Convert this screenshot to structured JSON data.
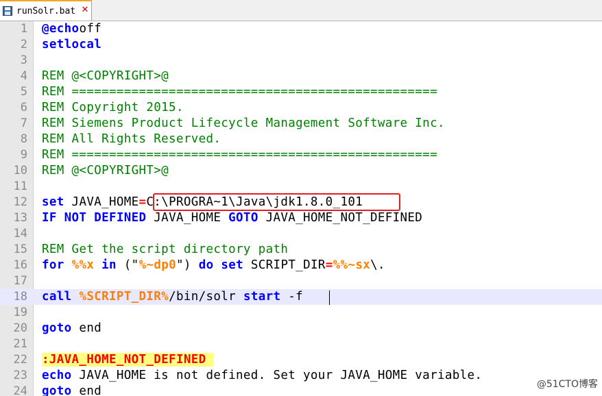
{
  "tab": {
    "title": "runSolr.bat",
    "icon": "save-icon",
    "close_icon": "close-icon"
  },
  "lines": [
    {
      "n": "1",
      "segs": [
        [
          "kw",
          "@echo"
        ],
        [
          "",
          "off"
        ]
      ]
    },
    {
      "n": "2",
      "segs": [
        [
          "kw",
          "setlocal"
        ]
      ]
    },
    {
      "n": "3",
      "segs": []
    },
    {
      "n": "4",
      "segs": [
        [
          "cmt",
          "REM @<COPYRIGHT>@"
        ]
      ]
    },
    {
      "n": "5",
      "segs": [
        [
          "cmt",
          "REM ================================================="
        ]
      ]
    },
    {
      "n": "6",
      "segs": [
        [
          "cmt",
          "REM Copyright 2015."
        ]
      ]
    },
    {
      "n": "7",
      "segs": [
        [
          "cmt",
          "REM Siemens Product Lifecycle Management Software Inc."
        ]
      ]
    },
    {
      "n": "8",
      "segs": [
        [
          "cmt",
          "REM All Rights Reserved."
        ]
      ]
    },
    {
      "n": "9",
      "segs": [
        [
          "cmt",
          "REM ================================================="
        ]
      ]
    },
    {
      "n": "10",
      "segs": [
        [
          "cmt",
          "REM @<COPYRIGHT>@"
        ]
      ]
    },
    {
      "n": "11",
      "segs": []
    },
    {
      "n": "12",
      "segs": [
        [
          "kw",
          "set"
        ],
        [
          "",
          " JAVA_HOME"
        ],
        [
          "op",
          "="
        ],
        [
          "",
          "C:\\PROGRA~1\\Java\\jdk1.8.0_101"
        ]
      ]
    },
    {
      "n": "13",
      "segs": [
        [
          "kw",
          "IF NOT DEFINED"
        ],
        [
          "",
          " JAVA_HOME "
        ],
        [
          "kw",
          "GOTO"
        ],
        [
          "",
          " JAVA_HOME_NOT_DEFINED"
        ]
      ]
    },
    {
      "n": "14",
      "segs": []
    },
    {
      "n": "15",
      "segs": [
        [
          "cmt",
          "REM Get the script directory path"
        ]
      ]
    },
    {
      "n": "16",
      "segs": [
        [
          "kw",
          "for"
        ],
        [
          "",
          " "
        ],
        [
          "var",
          "%%x"
        ],
        [
          "",
          " "
        ],
        [
          "kw",
          "in"
        ],
        [
          "",
          " (\""
        ],
        [
          "var",
          "%~dp0"
        ],
        [
          "",
          "\") "
        ],
        [
          "kw",
          "do set"
        ],
        [
          "",
          " SCRIPT_DIR"
        ],
        [
          "op",
          "="
        ],
        [
          "var",
          "%%~sx"
        ],
        [
          "",
          "\\."
        ]
      ]
    },
    {
      "n": "17",
      "segs": []
    },
    {
      "n": "18",
      "segs": [
        [
          "kw",
          "call"
        ],
        [
          "",
          " "
        ],
        [
          "var",
          "%SCRIPT_DIR%"
        ],
        [
          "",
          "/bin/solr "
        ],
        [
          "kw",
          "start"
        ],
        [
          "",
          " -f"
        ]
      ]
    },
    {
      "n": "19",
      "segs": []
    },
    {
      "n": "20",
      "segs": [
        [
          "kw",
          "goto"
        ],
        [
          "",
          " end"
        ]
      ]
    },
    {
      "n": "21",
      "segs": []
    },
    {
      "n": "22",
      "segs": [
        [
          "lbl",
          ":JAVA_HOME_NOT_DEFINED "
        ]
      ]
    },
    {
      "n": "23",
      "segs": [
        [
          "kw",
          "echo"
        ],
        [
          "",
          " JAVA_HOME is not defined. Set your JAVA_HOME variable."
        ]
      ]
    },
    {
      "n": "24",
      "segs": [
        [
          "kw",
          "goto"
        ],
        [
          "",
          " end"
        ]
      ]
    }
  ],
  "current_line": "18",
  "watermark": "@51CTO博客"
}
